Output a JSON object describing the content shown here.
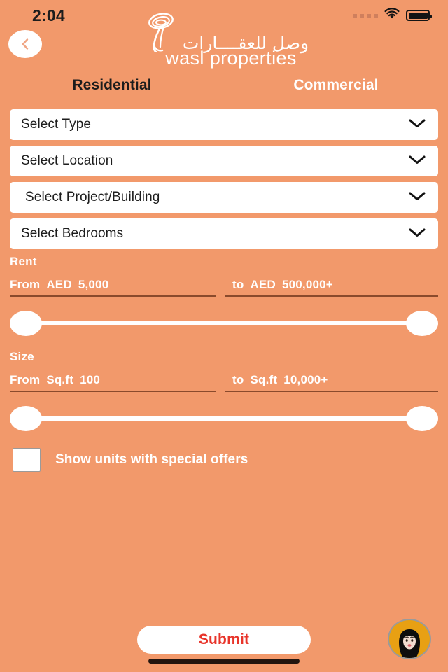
{
  "status_bar": {
    "time": "2:04",
    "signal_icon": "signal-dots-icon",
    "wifi_icon": "wifi-icon",
    "battery_icon": "battery-full-icon"
  },
  "header": {
    "back_icon": "chevron-left-icon",
    "logo_mark_icon": "wasl-swirl-logo-icon",
    "logo_arabic": "وصل للعقــــارات",
    "logo_word": "wasl properties"
  },
  "tabs": [
    {
      "label": "Residential",
      "active": true
    },
    {
      "label": "Commercial",
      "active": false
    }
  ],
  "dropdowns": [
    {
      "label": "Select Type",
      "icon": "chevron-down-icon"
    },
    {
      "label": "Select Location",
      "icon": "chevron-down-icon"
    },
    {
      "label": "Select Project/Building",
      "icon": "chevron-down-icon"
    },
    {
      "label": "Select Bedrooms",
      "icon": "chevron-down-icon"
    }
  ],
  "rent": {
    "title": "Rent",
    "from_label": "From",
    "from_unit": "AED",
    "from_value": "5,000",
    "to_label": "to",
    "to_unit": "AED",
    "to_value": "500,000+"
  },
  "size": {
    "title": "Size",
    "from_label": "From",
    "from_unit": "Sq.ft",
    "from_value": "100",
    "to_label": "to",
    "to_unit": "Sq.ft",
    "to_value": "10,000+"
  },
  "special_offers": {
    "label": "Show units with special offers",
    "checked": false
  },
  "footer": {
    "submit_label": "Submit",
    "chat_avatar_icon": "support-agent-avatar-icon"
  },
  "colors": {
    "background": "#f2996b",
    "card": "#ffffff",
    "tab_active": "#1c1c1c",
    "tab_inactive": "#ffffff",
    "submit_text": "#e8342a",
    "underline": "#8a4a2c",
    "avatar_bg": "#e8a013",
    "home_indicator": "#23150f"
  }
}
